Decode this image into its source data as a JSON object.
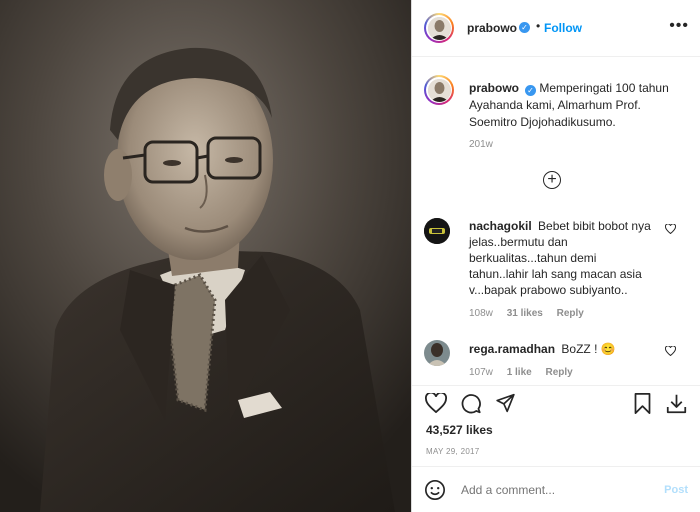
{
  "post": {
    "username": "prabowo",
    "verified_mark": "✓",
    "dot": "•",
    "follow_label": "Follow",
    "more_label": "•••"
  },
  "caption": {
    "username": "prabowo",
    "text": "Memperingati 100 tahun Ayahanda kami, Almarhum Prof. Soemitro Djojohadikusumo.",
    "age": "201w",
    "load_more": "+"
  },
  "comments": [
    {
      "username": "nachagokil",
      "text": "Bebet bibit bobot nya jelas..bermutu dan berkualitas...tahun demi tahun..lahir lah sang macan asia v...bapak prabowo subiyanto..",
      "age": "108w",
      "likes": "31 likes",
      "reply": "Reply"
    },
    {
      "username": "rega.ramadhan",
      "text": "BoZZ ! ",
      "emoji": "😊",
      "age": "107w",
      "likes": "1 like",
      "reply": "Reply"
    }
  ],
  "actions": {
    "icons": [
      "heart-icon",
      "comment-icon",
      "share-icon",
      "bookmark-icon",
      "download-icon"
    ],
    "likes_total": "43,527 likes",
    "date": "MAY 29, 2017"
  },
  "add_comment": {
    "placeholder": "Add a comment...",
    "post_label": "Post"
  },
  "colors": {
    "link_blue": "#0095f6",
    "verified_blue": "#3897f0",
    "muted": "#8e8e8e",
    "post_disabled": "#b2dffc"
  }
}
